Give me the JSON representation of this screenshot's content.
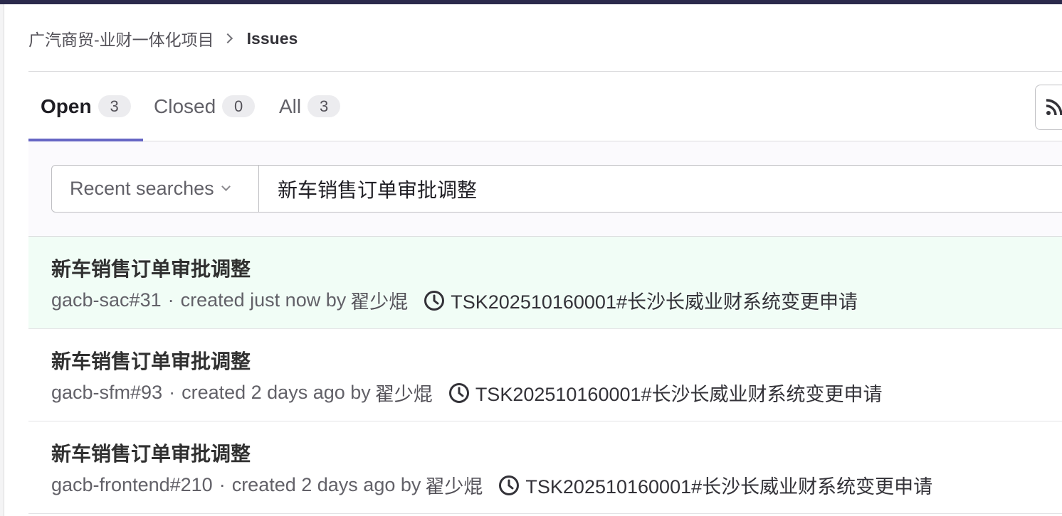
{
  "breadcrumb": {
    "project": "广汽商贸-业财一体化项目",
    "current": "Issues"
  },
  "tabs": [
    {
      "label": "Open",
      "count": "3"
    },
    {
      "label": "Closed",
      "count": "0"
    },
    {
      "label": "All",
      "count": "3"
    }
  ],
  "filter": {
    "recent_label": "Recent searches",
    "search_value": "新车销售订单审批调整"
  },
  "issues": [
    {
      "title": "新车销售订单审批调整",
      "ref": "gacb-sac#31",
      "created": "created just now",
      "by": "by",
      "author": "翟少焜",
      "milestone": "TSK202510160001#长沙长威业财系统变更申请"
    },
    {
      "title": "新车销售订单审批调整",
      "ref": "gacb-sfm#93",
      "created": "created 2 days ago",
      "by": "by",
      "author": "翟少焜",
      "milestone": "TSK202510160001#长沙长威业财系统变更申请"
    },
    {
      "title": "新车销售订单审批调整",
      "ref": "gacb-frontend#210",
      "created": "created 2 days ago",
      "by": "by",
      "author": "翟少焜",
      "milestone": "TSK202510160001#长沙长威业财系统变更申请"
    }
  ],
  "icons": {
    "rss": "rss-icon",
    "milestone": "clock-icon",
    "dropdown": "chevron-down-icon",
    "breadcrumb_sep": "chevron-right-icon"
  },
  "colors": {
    "top_bar": "#2b2a4c",
    "active_tab_underline": "#6666c4",
    "highlight_row": "#f1fdf6"
  }
}
